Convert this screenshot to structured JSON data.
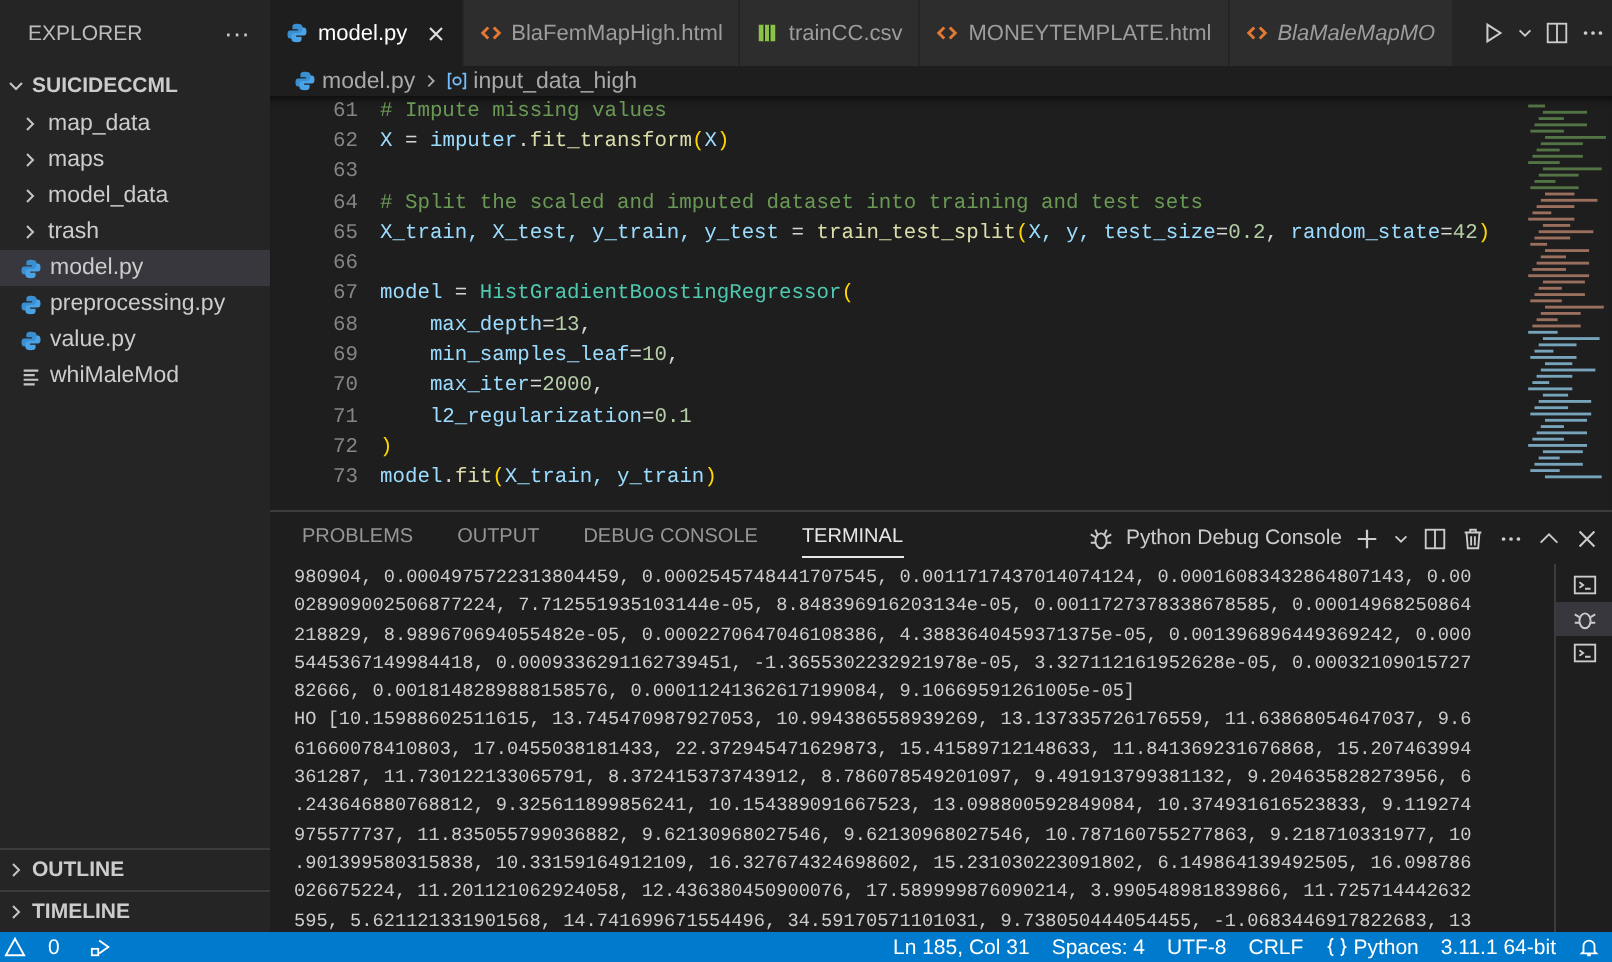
{
  "sidebar": {
    "title": "EXPLORER",
    "more": "···",
    "folder": {
      "name": "SUICIDECCML",
      "expanded": true,
      "children": [
        {
          "name": "map_data",
          "kind": "folder",
          "selected": false
        },
        {
          "name": "maps",
          "kind": "folder",
          "selected": false
        },
        {
          "name": "model_data",
          "kind": "folder",
          "selected": false
        },
        {
          "name": "trash",
          "kind": "folder",
          "selected": false
        },
        {
          "name": "model.py",
          "kind": "python",
          "selected": true
        },
        {
          "name": "preprocessing.py",
          "kind": "python",
          "selected": false
        },
        {
          "name": "value.py",
          "kind": "python",
          "selected": false
        },
        {
          "name": "whiMaleMod",
          "kind": "text",
          "selected": false
        }
      ]
    },
    "sections": [
      {
        "name": "OUTLINE",
        "expanded": false
      },
      {
        "name": "TIMELINE",
        "expanded": false
      }
    ]
  },
  "tabs": [
    {
      "label": "model.py",
      "kind": "python",
      "selected": true,
      "preview": false
    },
    {
      "label": "BlaFemMapHigh.html",
      "kind": "html",
      "selected": false,
      "preview": false
    },
    {
      "label": "trainCC.csv",
      "kind": "csv",
      "selected": false,
      "preview": false
    },
    {
      "label": "MONEYTEMPLATE.html",
      "kind": "html",
      "selected": false,
      "preview": false
    },
    {
      "label": "BlaMaleMapMO",
      "kind": "html",
      "selected": false,
      "preview": true
    }
  ],
  "breadcrumb": [
    {
      "label": "model.py",
      "kind": "python"
    },
    {
      "label": "input_data_high",
      "kind": "variable"
    }
  ],
  "code": [
    {
      "number": "61",
      "tokens": [
        {
          "text": "# Impute missing values",
          "kind": "comment"
        }
      ]
    },
    {
      "number": "62",
      "tokens": [
        {
          "text": "X",
          "kind": "var"
        },
        {
          "text": " = ",
          "kind": "plain"
        },
        {
          "text": "imputer",
          "kind": "var"
        },
        {
          "text": ".",
          "kind": "plain"
        },
        {
          "text": "fit_transform",
          "kind": "func"
        },
        {
          "text": "(",
          "kind": "paren"
        },
        {
          "text": "X",
          "kind": "var"
        },
        {
          "text": ")",
          "kind": "paren"
        }
      ]
    },
    {
      "number": "63"
    },
    {
      "number": "64",
      "tokens": [
        {
          "text": "# Split the scaled and imputed dataset into training and test sets",
          "kind": "comment"
        }
      ]
    },
    {
      "number": "65",
      "tokens": [
        {
          "text": "X_train, X_test, y_train, y_test",
          "kind": "var"
        },
        {
          "text": " = ",
          "kind": "plain"
        },
        {
          "text": "train_test_split",
          "kind": "func"
        },
        {
          "text": "(",
          "kind": "paren"
        },
        {
          "text": "X, y, test_size",
          "kind": "var"
        },
        {
          "text": "=",
          "kind": "plain"
        },
        {
          "text": "0.2",
          "kind": "num"
        },
        {
          "text": ", ",
          "kind": "plain"
        },
        {
          "text": "random_state",
          "kind": "var"
        },
        {
          "text": "=",
          "kind": "plain"
        },
        {
          "text": "42",
          "kind": "num"
        },
        {
          "text": ")",
          "kind": "paren"
        }
      ]
    },
    {
      "number": "66"
    },
    {
      "number": "67",
      "tokens": [
        {
          "text": "model",
          "kind": "var"
        },
        {
          "text": " = ",
          "kind": "plain"
        },
        {
          "text": "HistGradientBoostingRegressor",
          "kind": "class"
        },
        {
          "text": "(",
          "kind": "paren"
        }
      ]
    },
    {
      "number": "68",
      "tokens": [
        {
          "text": "    max_depth",
          "kind": "var"
        },
        {
          "text": "=",
          "kind": "plain"
        },
        {
          "text": "13",
          "kind": "num"
        },
        {
          "text": ",",
          "kind": "plain"
        }
      ]
    },
    {
      "number": "69",
      "tokens": [
        {
          "text": "    min_samples_leaf",
          "kind": "var"
        },
        {
          "text": "=",
          "kind": "plain"
        },
        {
          "text": "10",
          "kind": "num"
        },
        {
          "text": ",",
          "kind": "plain"
        }
      ]
    },
    {
      "number": "70",
      "tokens": [
        {
          "text": "    max_iter",
          "kind": "var"
        },
        {
          "text": "=",
          "kind": "plain"
        },
        {
          "text": "2000",
          "kind": "num"
        },
        {
          "text": ",",
          "kind": "plain"
        }
      ]
    },
    {
      "number": "71",
      "tokens": [
        {
          "text": "    l2_regularization",
          "kind": "var"
        },
        {
          "text": "=",
          "kind": "plain"
        },
        {
          "text": "0.1",
          "kind": "num"
        }
      ]
    },
    {
      "number": "72",
      "tokens": [
        {
          "text": ")",
          "kind": "paren"
        }
      ]
    },
    {
      "number": "73",
      "tokens": [
        {
          "text": "model",
          "kind": "var"
        },
        {
          "text": ".",
          "kind": "plain"
        },
        {
          "text": "fit",
          "kind": "func"
        },
        {
          "text": "(",
          "kind": "paren"
        },
        {
          "text": "X_train, y_train",
          "kind": "var"
        },
        {
          "text": ")",
          "kind": "paren"
        }
      ]
    }
  ],
  "panel": {
    "tabs": [
      {
        "label": "PROBLEMS",
        "selected": false
      },
      {
        "label": "OUTPUT",
        "selected": false
      },
      {
        "label": "DEBUG CONSOLE",
        "selected": false
      },
      {
        "label": "TERMINAL",
        "selected": true
      }
    ],
    "terminal_name": "Python Debug Console",
    "terminal_list": [
      {
        "kind": "terminal",
        "selected": false
      },
      {
        "kind": "debug",
        "selected": true
      },
      {
        "kind": "terminal",
        "selected": false
      }
    ],
    "lines": [
      "980904, 0.0004975722313804459, 0.0002545748441707545, 0.0011717437014074124, 0.00016083432864807143, 0.00",
      "028909002506877224, 7.712551935103144e-05, 8.848396916203134e-05, 0.0011727378338678585, 0.00014968250864",
      "218829, 8.989670694055482e-05, 0.0002270647046108386, 4.3883640459371375e-05, 0.001396896449369242, 0.000",
      "5445367149984418, 0.0009336291162739451, -1.3655302232921978e-05, 3.327112161952628e-05, 0.00032109015727",
      "82666, 0.0018148289888158576, 0.00011241362617199084, 9.10669591261005e-05]",
      "HO [10.15988602511615, 13.745470987927053, 10.994386558939269, 13.137335726176559, 11.63868054647037, 9.6",
      "61660078410803, 17.0455038181433, 22.372945471629873, 15.41589712148633, 11.841369231676868, 15.207463994",
      "361287, 11.730122133065791, 8.372415373743912, 8.786078549201097, 9.491913799381132, 9.204635828273956, 6",
      ".243646880768812, 9.325611899856241, 10.154389091667523, 13.098800592849084, 10.374931616523833, 9.119274",
      "975577737, 11.835055799036882, 9.62130968027546, 9.62130968027546, 10.787160755277863, 9.218710331977, 10",
      ".901399580315838, 10.33159164912109, 16.327674324698602, 15.231030223091802, 6.149864139492505, 16.098786",
      "026675224, 11.201121062924058, 12.436380450900076, 17.589999876090214, 3.990548981839866, 11.725714442632",
      "595, 5.621121331901568, 14.741699671554496, 34.59170571101031, 9.738050444054455, -1.0683446917822683, 13"
    ]
  },
  "status_bar": {
    "warnings": "0",
    "right": [
      {
        "text": "Ln 185, Col 31",
        "kind": "plain"
      },
      {
        "text": "Spaces: 4",
        "kind": "plain"
      },
      {
        "text": "UTF-8",
        "kind": "plain"
      },
      {
        "text": "CRLF",
        "kind": "plain"
      },
      {
        "text": "Python",
        "kind": "language"
      },
      {
        "text": "3.11.1 64-bit",
        "kind": "plain"
      }
    ]
  }
}
